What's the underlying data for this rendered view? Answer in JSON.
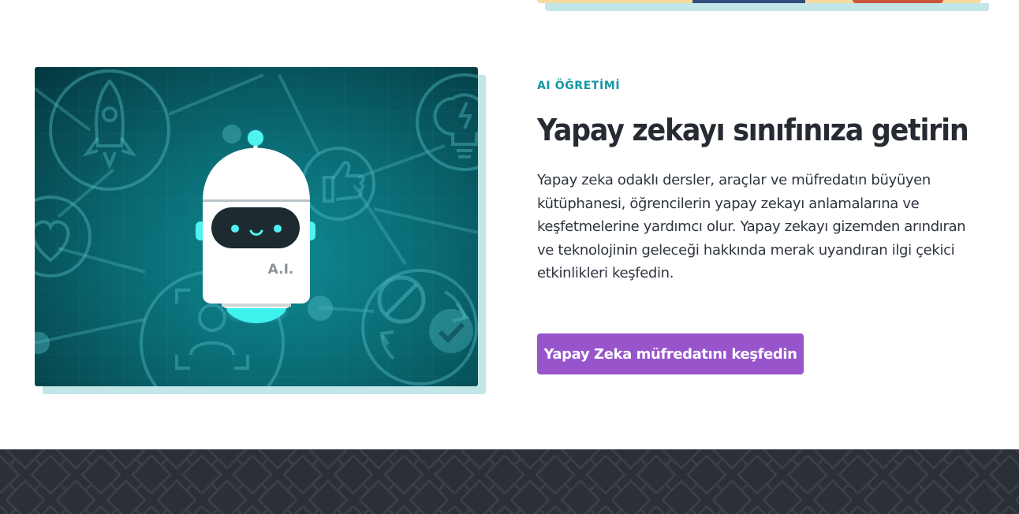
{
  "section": {
    "eyebrow": "AI ÖĞRETİMİ",
    "title": "Yapay zekayı sınıfınıza getirin",
    "description": "Yapay zeka odaklı dersler, araçlar ve müfredatın büyüyen kütüphanesi, öğrencilerin yapay zekayı anlamalarına ve keşfetmelerine yardımcı olur. Yapay zekayı gizemden arındıran ve teknolojinin geleceği hakkında merak uyandıran ilgi çekici etkinlikleri keşfedin.",
    "cta_label": "Yapay Zeka müfredatını keşfedin"
  },
  "illustration": {
    "robot_badge": "A.I.",
    "icons": [
      "rocket-icon",
      "lightbulb-icon",
      "thumbs-up-icon",
      "heart-icon",
      "no-sign-icon",
      "checkmark-icon",
      "person-icon",
      "refresh-arrows-icon"
    ]
  },
  "colors": {
    "accent_teal": "#1596a3",
    "button_purple": "#9855cb",
    "heading": "#262b33",
    "footer": "#2b2f36",
    "image_shadow": "#c3e6e8"
  }
}
